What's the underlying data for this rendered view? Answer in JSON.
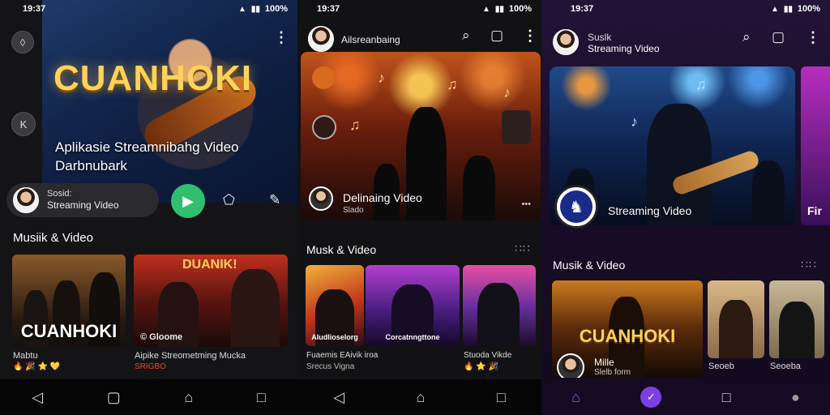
{
  "screen1": {
    "status": {
      "time": "19:37",
      "battery": "100%"
    },
    "hero_title": "CUANHOKI",
    "hero_subtitle": "Aplikasie Streamnibahg Video Darbnubark",
    "left_btn_top": "◊",
    "left_btn_k": "K",
    "pill": {
      "line1": "Sosid:",
      "line2": "Streaming Video"
    },
    "section_title": "Musiik & Video",
    "card1_overlay": "CUANHOKI",
    "card1_caption": "Mabtu",
    "card2_banner": "DUANIK!",
    "card2_overlay": "© Gloome",
    "card2_caption": "Aipike Streometming Mucka",
    "card2_subcaption": "SRIGBO",
    "emoji_row": "🔥 🎉 ⭐ 💛"
  },
  "screen2": {
    "status": {
      "time": "19:37",
      "battery": "100%"
    },
    "header_title": "Ailsreanbaing",
    "hero_caption": "Delinaing Video",
    "hero_sub": "Slado",
    "section_title": "Musk & Video",
    "card1_overlay": "Aludlioselorg",
    "card2_overlay": "Corcatnngttone",
    "caption_left": "Fuaemis EAivik iroa",
    "caption_left_sub": "Srecus Vigna",
    "caption_right": "Stuoda Vikde",
    "emoji_row": "🔥 ⭐ 🎉"
  },
  "screen3": {
    "status": {
      "time": "19:37",
      "battery": "100%"
    },
    "header_line1": "Suslk",
    "header_line2": "Streaming Video",
    "hero_caption": "Streaming Video",
    "side_caption": "Fir",
    "section_title": "Musik & Video",
    "card1_overlay": "CUANHOKI",
    "card1_caption": "Mille",
    "card1_subcaption": "Slelb form",
    "card2_caption": "Seoeb",
    "card3_caption": "Seoeba"
  },
  "colors": {
    "accent_green": "#2fbf6e",
    "accent_purple": "#7b3fe4",
    "gold": "#ffd25a"
  },
  "icons": [
    "search-icon",
    "cast-icon",
    "more-vert-icon",
    "back-icon",
    "home-icon",
    "recents-icon",
    "play-icon",
    "share-icon",
    "edit-icon",
    "profile-icon"
  ]
}
